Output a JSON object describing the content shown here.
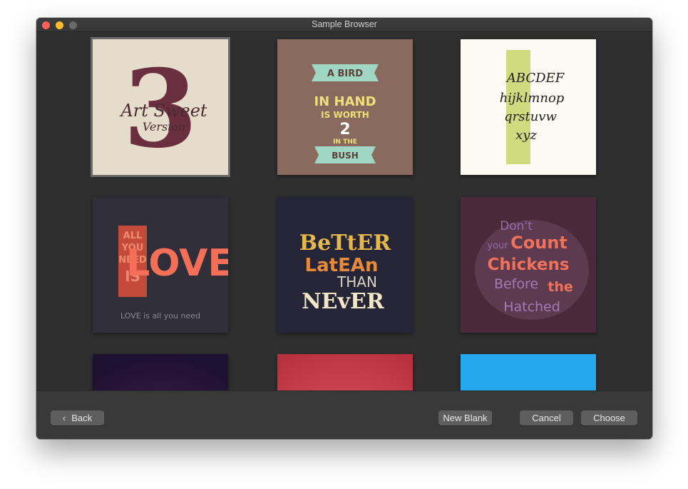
{
  "window": {
    "title": "Sample Browser"
  },
  "samples": [
    {
      "text": [
        "3",
        "Art Sweet",
        "Version"
      ]
    },
    {
      "text": [
        "A BIRD",
        "IN HAND",
        "IS WORTH",
        "2",
        "IN THE",
        "BUSH"
      ]
    },
    {
      "text": [
        "ABCDEF",
        "hijklmnop",
        "qrstuvw",
        "xyz"
      ]
    },
    {
      "text": [
        "ALL",
        "YOU",
        "NEED",
        "IS",
        "LOVE",
        "LOVE is all you need"
      ]
    },
    {
      "text": [
        "BeTtER",
        "LatEAn",
        "THAN",
        "NEvER"
      ]
    },
    {
      "text": [
        "Don't",
        "Count",
        "your",
        "Chickens",
        "Before",
        "the",
        "Hatched"
      ]
    },
    {
      "text": []
    },
    {
      "text": []
    },
    {
      "text": []
    }
  ],
  "footer": {
    "back_label": "Back",
    "new_blank_label": "New Blank",
    "cancel_label": "Cancel",
    "choose_label": "Choose"
  },
  "colors": {
    "window_bg": "#323232",
    "footer_bg": "#393939",
    "button_bg": "#5e5e5e",
    "close": "#fe5f57",
    "minimize": "#febc2e"
  }
}
